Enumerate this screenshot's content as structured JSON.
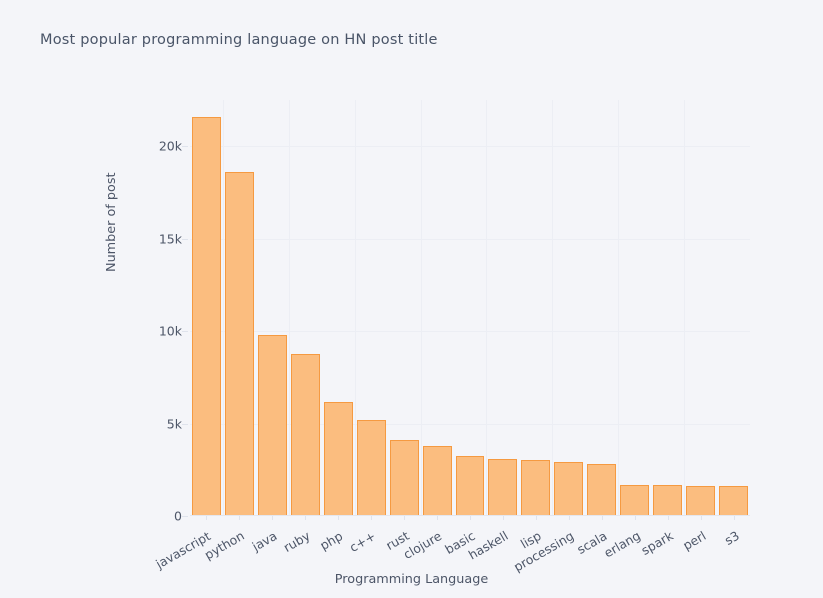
{
  "chart_data": {
    "type": "bar",
    "title": "Most popular programming language on HN post title",
    "xlabel": "Programming Language",
    "ylabel": "Number of post",
    "categories": [
      "javascript",
      "python",
      "java",
      "ruby",
      "php",
      "c++",
      "rust",
      "clojure",
      "basic",
      "haskell",
      "lisp",
      "processing",
      "scala",
      "erlang",
      "spark",
      "perl",
      "s3"
    ],
    "values": [
      21580,
      18630,
      9810,
      8770,
      6160,
      5180,
      4090,
      3810,
      3270,
      3110,
      3050,
      2940,
      2830,
      1690,
      1660,
      1640,
      1600
    ],
    "ylim": [
      0,
      22500
    ],
    "ytick_values": [
      0,
      5000,
      10000,
      15000,
      20000
    ],
    "ytick_labels": [
      "0",
      "5k",
      "10k",
      "15k",
      "20k"
    ],
    "grid": true,
    "legend": "none",
    "bar_color": "#fbbd7f",
    "bar_edge_color": "#f59a41",
    "background_color": "#f4f5f9",
    "gridline_color": "#eceef4",
    "text_color": "#4d5668",
    "title_color": "#4a5568"
  }
}
